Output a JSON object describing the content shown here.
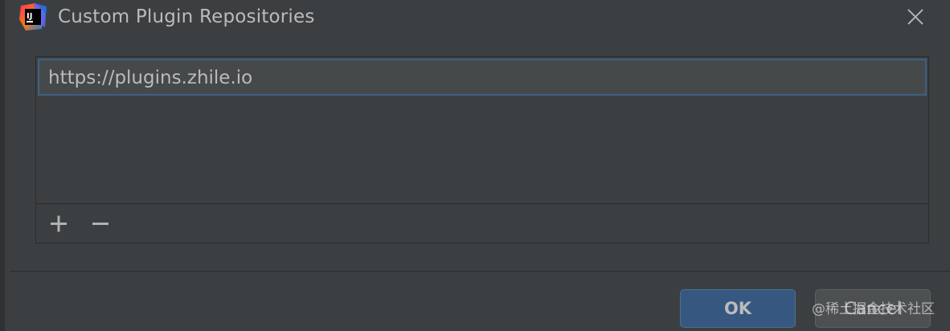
{
  "window": {
    "title": "Custom Plugin Repositories",
    "app_icon": "intellij-idea-icon",
    "close_icon": "close-icon"
  },
  "repositories": {
    "items": [
      {
        "url": "https://plugins.zhile.io",
        "selected": true
      }
    ]
  },
  "toolbar": {
    "add_icon": "plus-icon",
    "remove_icon": "minus-icon"
  },
  "buttons": {
    "ok_label": "OK",
    "cancel_label": "Cancel"
  },
  "watermark": {
    "text": "@稀土掘金技术社区"
  },
  "colors": {
    "background": "#3c3f41",
    "selection_border": "#3d6185",
    "primary_button": "#365880",
    "text": "#bbbbbb"
  }
}
